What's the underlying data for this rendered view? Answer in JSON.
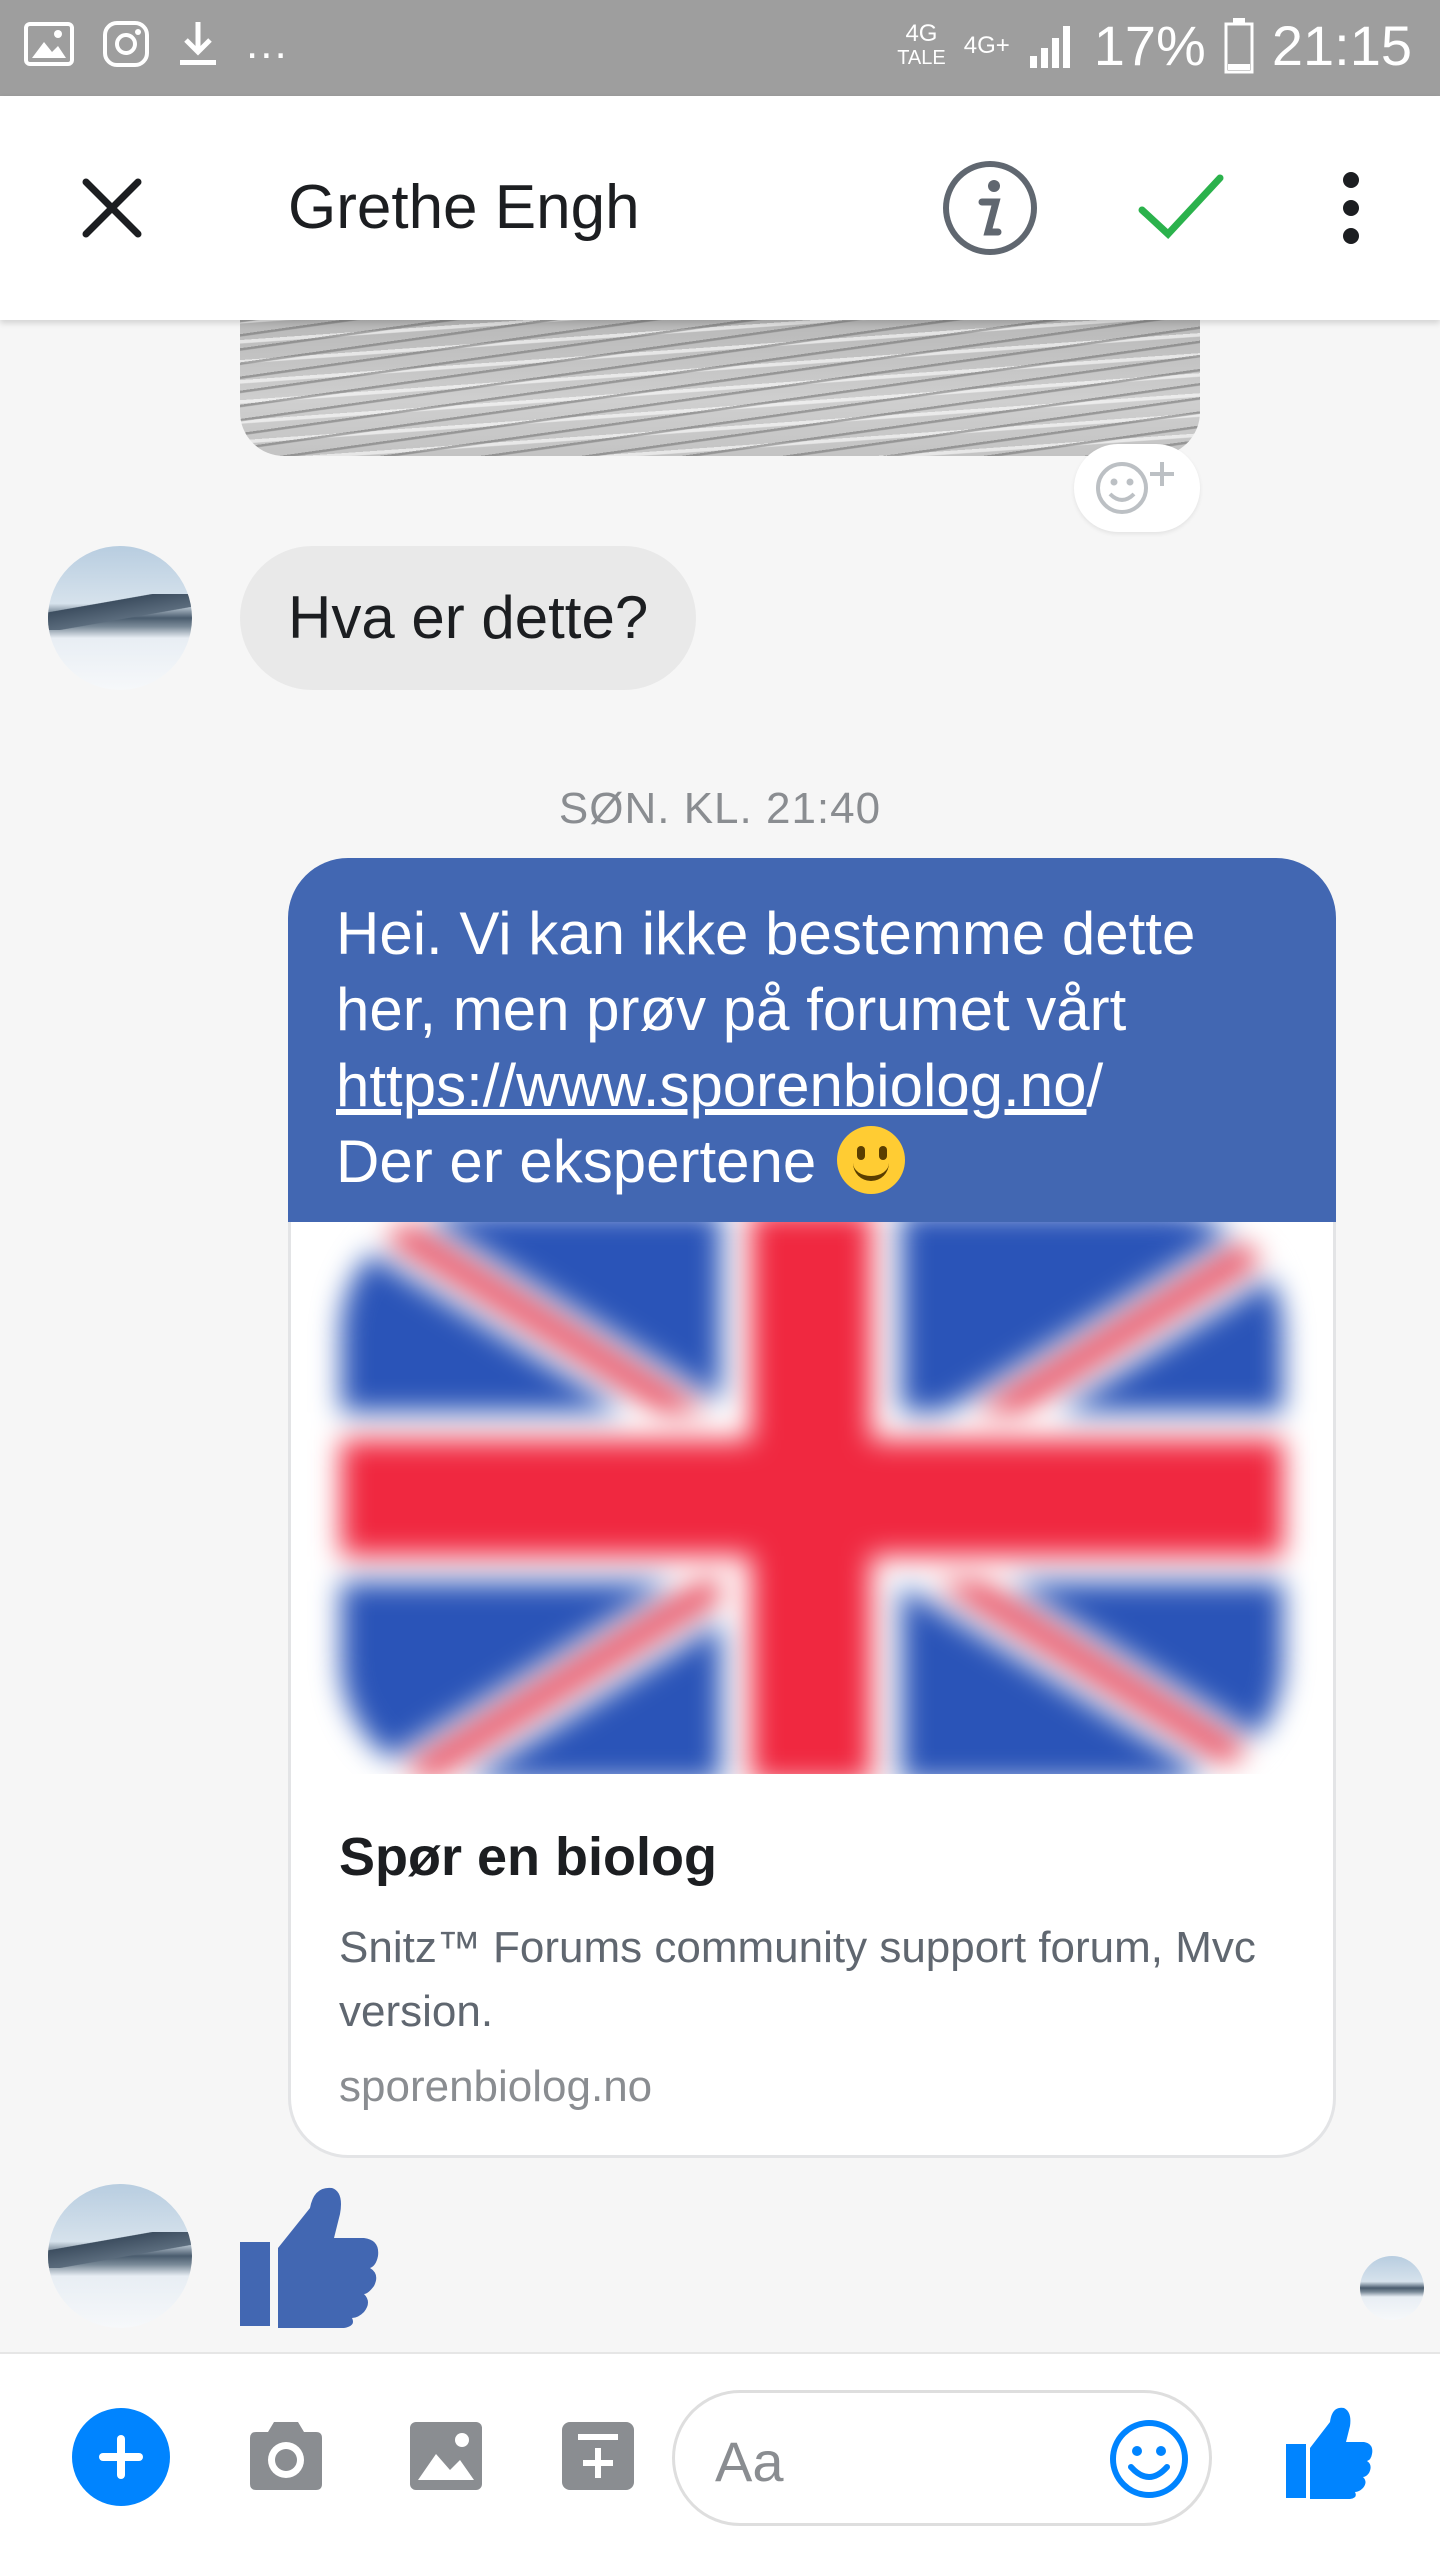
{
  "status_bar": {
    "network_top": "4G",
    "network_bottom": "TALE",
    "network2": "4G+",
    "battery": "17%",
    "time": "21:15",
    "more": "...",
    "icons": [
      "gallery-icon",
      "instagram-icon",
      "download-icon",
      "signal-icon",
      "battery-icon"
    ]
  },
  "header": {
    "contact_name": "Grethe Engh",
    "icons": [
      "close-icon",
      "info-icon",
      "check-icon",
      "more-vertical-icon"
    ],
    "accent": "#2bb24c"
  },
  "conversation": {
    "incoming_message": "Hva er dette?",
    "timestamp": "SØN. KL. 21:40",
    "outgoing": {
      "line1": "Hei. Vi kan ikke bestemme dette",
      "line2": "her, men prøv på forumet vårt",
      "link": "https://www.sporenbiolog.no",
      "link_tail": "/",
      "line4": "Der er ekspertene",
      "emoji": "slightly-smiling-face"
    },
    "link_card": {
      "title": "Spør en biolog",
      "description": "Snitz™ Forums community support forum, Mvc version.",
      "domain": "sporenbiolog.no"
    },
    "reply_sticker": "thumbs-up-sticker"
  },
  "composer": {
    "placeholder": "Aa",
    "icons": [
      "add-icon",
      "camera-icon",
      "image-icon",
      "compose-icon",
      "emoji-icon",
      "like-icon"
    ]
  },
  "colors": {
    "outgoing_bubble": "#4267b2",
    "incoming_bubble": "#e9e9e9",
    "messenger_blue": "#0084ff",
    "status_bar": "#9e9e9e"
  }
}
